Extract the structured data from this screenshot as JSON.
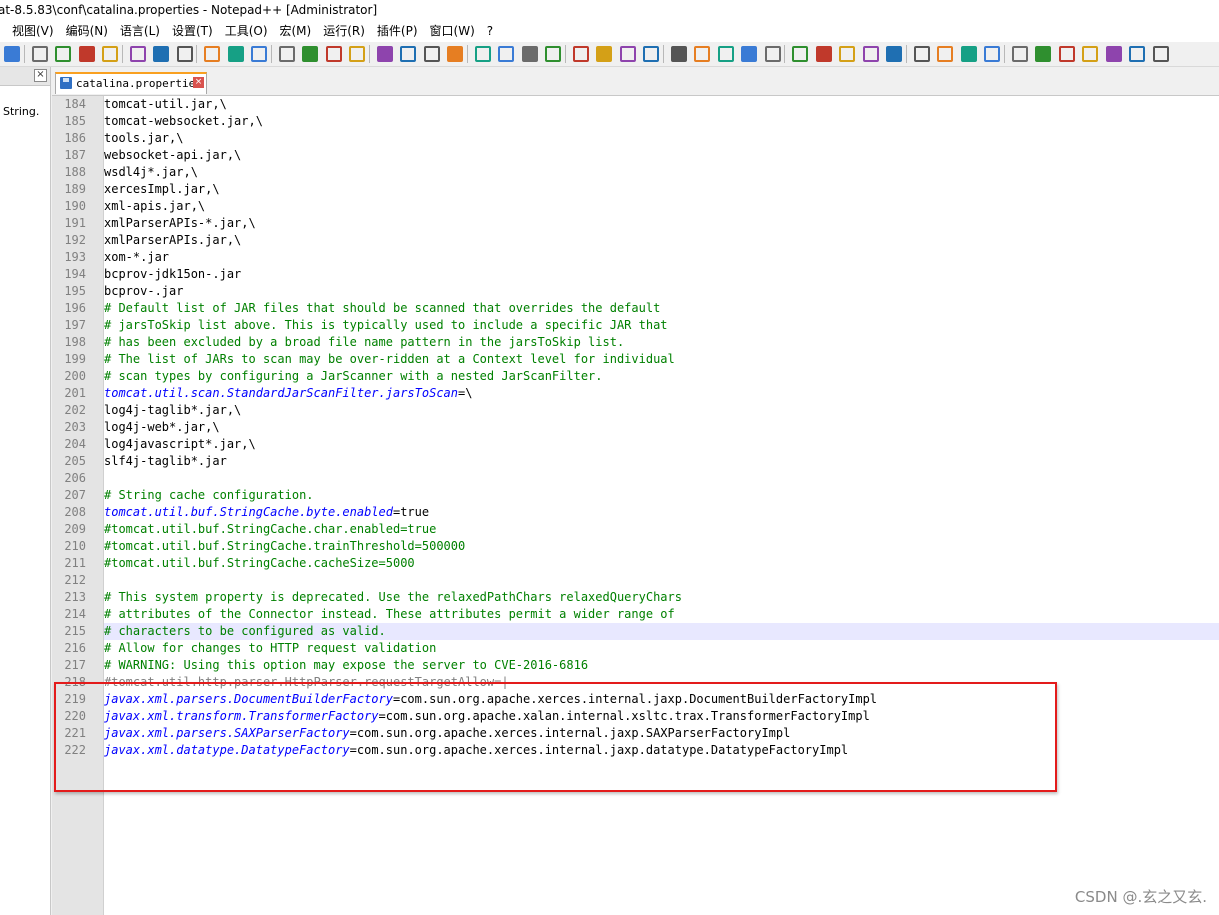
{
  "window": {
    "title": "at-8.5.83\\conf\\catalina.properties - Notepad++ [Administrator]"
  },
  "menu": [
    "视图(V)",
    "编码(N)",
    "语言(L)",
    "设置(T)",
    "工具(O)",
    "宏(M)",
    "运行(R)",
    "插件(P)",
    "窗口(W)",
    "?"
  ],
  "side_panel": {
    "text": "String.",
    "close_label": "×"
  },
  "tab": {
    "label": "catalina.properties",
    "close_label": "×"
  },
  "colors": {
    "highlight_border": "#e31b1b",
    "tab_accent": "#f9a020",
    "keyword": "#0000ff",
    "comment": "#008000"
  },
  "editor": {
    "lines": [
      {
        "n": "184",
        "t": "tomcat-util.jar,\\",
        "k": "plain"
      },
      {
        "n": "185",
        "t": "tomcat-websocket.jar,\\",
        "k": "plain"
      },
      {
        "n": "186",
        "t": "tools.jar,\\",
        "k": "plain"
      },
      {
        "n": "187",
        "t": "websocket-api.jar,\\",
        "k": "plain"
      },
      {
        "n": "188",
        "t": "wsdl4j*.jar,\\",
        "k": "plain"
      },
      {
        "n": "189",
        "t": "xercesImpl.jar,\\",
        "k": "plain"
      },
      {
        "n": "190",
        "t": "xml-apis.jar,\\",
        "k": "plain"
      },
      {
        "n": "191",
        "t": "xmlParserAPIs-*.jar,\\",
        "k": "plain"
      },
      {
        "n": "192",
        "t": "xmlParserAPIs.jar,\\",
        "k": "plain"
      },
      {
        "n": "193",
        "t": "xom-*.jar",
        "k": "plain"
      },
      {
        "n": "194",
        "t": "bcprov-jdk15on-.jar",
        "k": "plain"
      },
      {
        "n": "195",
        "t": "bcprov-.jar",
        "k": "plain"
      },
      {
        "n": "196",
        "t": "# Default list of JAR files that should be scanned that overrides the default",
        "k": "comment"
      },
      {
        "n": "197",
        "t": "# jarsToSkip list above. This is typically used to include a specific JAR that",
        "k": "comment"
      },
      {
        "n": "198",
        "t": "# has been excluded by a broad file name pattern in the jarsToSkip list.",
        "k": "comment"
      },
      {
        "n": "199",
        "t": "# The list of JARs to scan may be over-ridden at a Context level for individual",
        "k": "comment"
      },
      {
        "n": "200",
        "t": "# scan types by configuring a JarScanner with a nested JarScanFilter.",
        "k": "comment"
      },
      {
        "n": "201",
        "key": "tomcat.util.scan.StandardJarScanFilter.jarsToScan",
        "val": "=\\",
        "k": "kv"
      },
      {
        "n": "202",
        "t": "log4j-taglib*.jar,\\",
        "k": "plain"
      },
      {
        "n": "203",
        "t": "log4j-web*.jar,\\",
        "k": "plain"
      },
      {
        "n": "204",
        "t": "log4javascript*.jar,\\",
        "k": "plain"
      },
      {
        "n": "205",
        "t": "slf4j-taglib*.jar",
        "k": "plain"
      },
      {
        "n": "206",
        "t": "",
        "k": "plain"
      },
      {
        "n": "207",
        "t": "# String cache configuration.",
        "k": "comment"
      },
      {
        "n": "208",
        "key": "tomcat.util.buf.StringCache.byte.enabled",
        "val": "=true",
        "k": "kv"
      },
      {
        "n": "209",
        "t": "#tomcat.util.buf.StringCache.char.enabled=true",
        "k": "comment"
      },
      {
        "n": "210",
        "t": "#tomcat.util.buf.StringCache.trainThreshold=500000",
        "k": "comment"
      },
      {
        "n": "211",
        "t": "#tomcat.util.buf.StringCache.cacheSize=5000",
        "k": "comment"
      },
      {
        "n": "212",
        "t": "",
        "k": "plain"
      },
      {
        "n": "213",
        "t": "# This system property is deprecated. Use the relaxedPathChars relaxedQueryChars",
        "k": "comment"
      },
      {
        "n": "214",
        "t": "# attributes of the Connector instead. These attributes permit a wider range of",
        "k": "comment"
      },
      {
        "n": "215",
        "t": "# characters to be configured as valid.",
        "k": "comment",
        "hl": true
      },
      {
        "n": "216",
        "t": "# Allow for changes to HTTP request validation",
        "k": "comment"
      },
      {
        "n": "217",
        "t": "# WARNING: Using this option may expose the server to CVE-2016-6816",
        "k": "comment"
      },
      {
        "n": "218",
        "t": "#tomcat.util.http.parser.HttpParser.requestTargetAllow=|",
        "k": "struck"
      },
      {
        "n": "219",
        "key": "javax.xml.parsers.DocumentBuilderFactory",
        "val": "=com.sun.org.apache.xerces.internal.jaxp.DocumentBuilderFactoryImpl",
        "k": "kv"
      },
      {
        "n": "220",
        "key": "javax.xml.transform.TransformerFactory",
        "val": "=com.sun.org.apache.xalan.internal.xsltc.trax.TransformerFactoryImpl",
        "k": "kv"
      },
      {
        "n": "221",
        "key": "javax.xml.parsers.SAXParserFactory",
        "val": "=com.sun.org.apache.xerces.internal.jaxp.SAXParserFactoryImpl",
        "k": "kv"
      },
      {
        "n": "222",
        "key": "javax.xml.datatype.DatatypeFactory",
        "val": "=com.sun.org.apache.xerces.internal.jaxp.datatype.DatatypeFactoryImpl",
        "k": "kv"
      }
    ]
  },
  "watermark": "CSDN @.玄之又玄."
}
